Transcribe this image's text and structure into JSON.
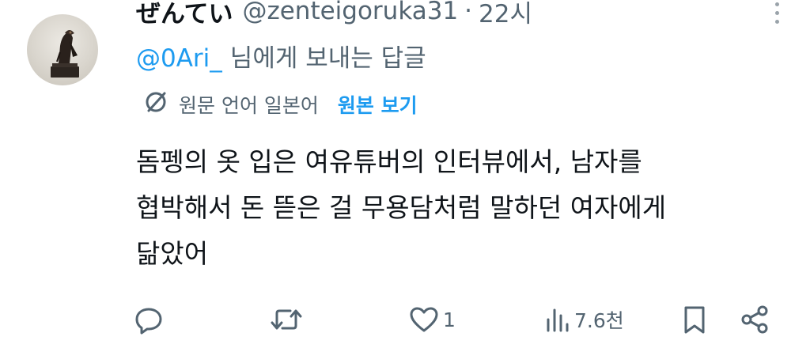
{
  "tweet": {
    "display_name": "ぜんてい",
    "handle": "@zenteigoruka31",
    "separator": "·",
    "time": "22시",
    "reply_to": {
      "mention": "@0Ari_",
      "suffix": "님에게 보내는 답글"
    },
    "translation": {
      "note": "원문 언어 일본어",
      "show_original": "원본 보기"
    },
    "body_lines": [
      "돔펭의 옷 입은 여유튜버의 인터뷰에서, 남자를",
      "협박해서 돈 뜯은 걸 무용담처럼 말하던 여자에게",
      "닮았어"
    ],
    "actions": {
      "reply_icon": "reply-icon",
      "retweet_icon": "retweet-icon",
      "like_icon": "heart-icon",
      "like_count": "1",
      "views_icon": "views-icon",
      "views_count": "7.6천",
      "bookmark_icon": "bookmark-icon",
      "share_icon": "share-icon"
    }
  },
  "colors": {
    "accent": "#1d9bf0",
    "text": "#0f1419",
    "muted": "#536471"
  }
}
